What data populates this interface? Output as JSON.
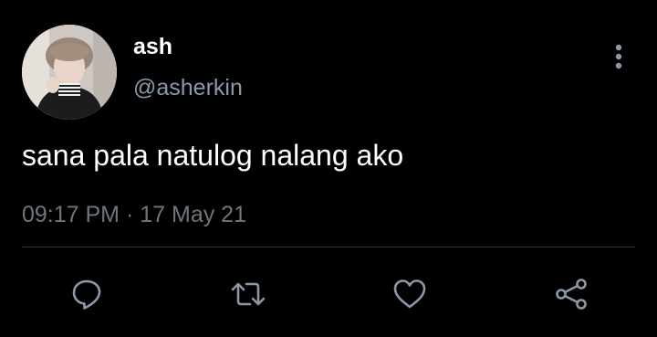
{
  "tweet": {
    "display_name": "ash",
    "handle": "@asherkin",
    "text": "sana pala natulog nalang ako",
    "time": "09:17 PM",
    "separator": "·",
    "date": "17 May 21"
  },
  "icons": {
    "more": "more-vertical-icon",
    "reply": "reply-icon",
    "retweet": "retweet-icon",
    "like": "like-heart-icon",
    "share": "share-icon"
  },
  "colors": {
    "background": "#000000",
    "primary_text": "#ffffff",
    "secondary_text": "#8b98a5",
    "meta_text": "#6e767d",
    "icon": "#8b98a5",
    "divider": "#2f3336"
  }
}
